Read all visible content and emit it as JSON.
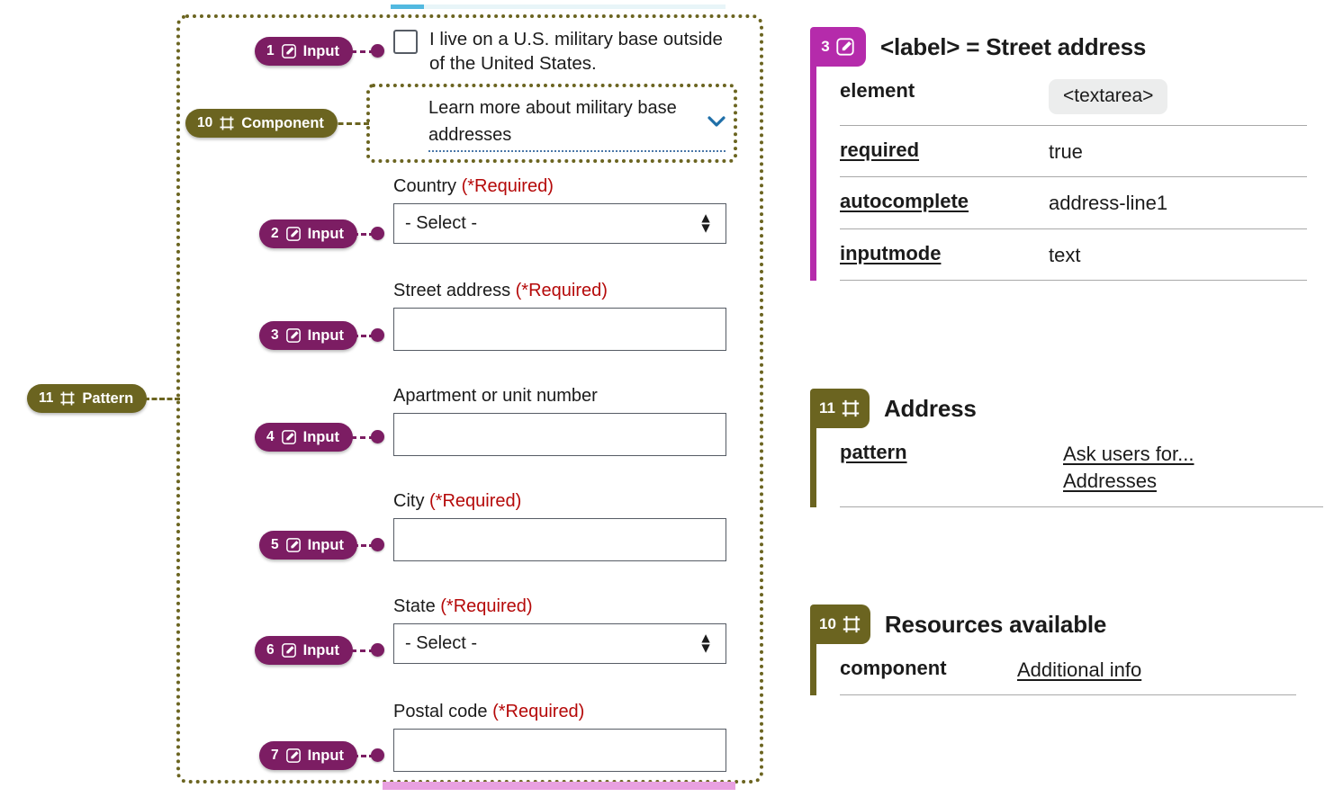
{
  "progress": {
    "label": "form-progress-bar",
    "percent": 10
  },
  "form": {
    "checkbox": {
      "label": "I live on a U.S. military base outside of the United States.",
      "checked": false
    },
    "accordion": {
      "label": "Learn more about military base addresses",
      "chevron": "chevron-down-icon"
    },
    "fields": [
      {
        "label": "Country",
        "required_text": "(*Required)",
        "type": "select",
        "value": "- Select -"
      },
      {
        "label": "Street address",
        "required_text": "(*Required)",
        "type": "text",
        "value": ""
      },
      {
        "label": "Apartment or unit number",
        "required_text": "",
        "type": "text",
        "value": ""
      },
      {
        "label": "City",
        "required_text": "(*Required)",
        "type": "text",
        "value": ""
      },
      {
        "label": "State",
        "required_text": "(*Required)",
        "type": "select",
        "value": "- Select -"
      },
      {
        "label": "Postal code",
        "required_text": "(*Required)",
        "type": "text",
        "value": ""
      }
    ]
  },
  "markers": [
    {
      "num": "1",
      "kind": "Input",
      "icon": "edit-square-icon"
    },
    {
      "num": "10",
      "kind": "Component",
      "icon": "frame-icon"
    },
    {
      "num": "2",
      "kind": "Input",
      "icon": "edit-square-icon"
    },
    {
      "num": "3",
      "kind": "Input",
      "icon": "edit-square-icon"
    },
    {
      "num": "11",
      "kind": "Pattern",
      "icon": "frame-icon"
    },
    {
      "num": "4",
      "kind": "Input",
      "icon": "edit-square-icon"
    },
    {
      "num": "5",
      "kind": "Input",
      "icon": "edit-square-icon"
    },
    {
      "num": "6",
      "kind": "Input",
      "icon": "edit-square-icon"
    },
    {
      "num": "7",
      "kind": "Input",
      "icon": "edit-square-icon"
    }
  ],
  "cards": [
    {
      "num": "3",
      "icon": "edit-square-icon",
      "accent": "#b52bab",
      "title": "<label> = Street address",
      "rows": [
        {
          "key": "element",
          "key_underlined": false,
          "value": "<textarea>",
          "value_style": "pill"
        },
        {
          "key": "required",
          "key_underlined": true,
          "value": "true",
          "value_style": "plain"
        },
        {
          "key": "autocomplete",
          "key_underlined": true,
          "value": "address-line1",
          "value_style": "plain"
        },
        {
          "key": "inputmode",
          "key_underlined": true,
          "value": "text",
          "value_style": "plain"
        }
      ]
    },
    {
      "num": "11",
      "icon": "frame-icon",
      "accent": "#6b6420",
      "title": "Address",
      "rows": [
        {
          "key": "pattern",
          "key_underlined": true,
          "value": "Ask users for... Addresses",
          "value_style": "link"
        }
      ]
    },
    {
      "num": "10",
      "icon": "frame-icon",
      "accent": "#6b6420",
      "title": "Resources available",
      "rows": [
        {
          "key": "component",
          "key_underlined": false,
          "value": "Additional info",
          "value_style": "link"
        }
      ]
    }
  ]
}
